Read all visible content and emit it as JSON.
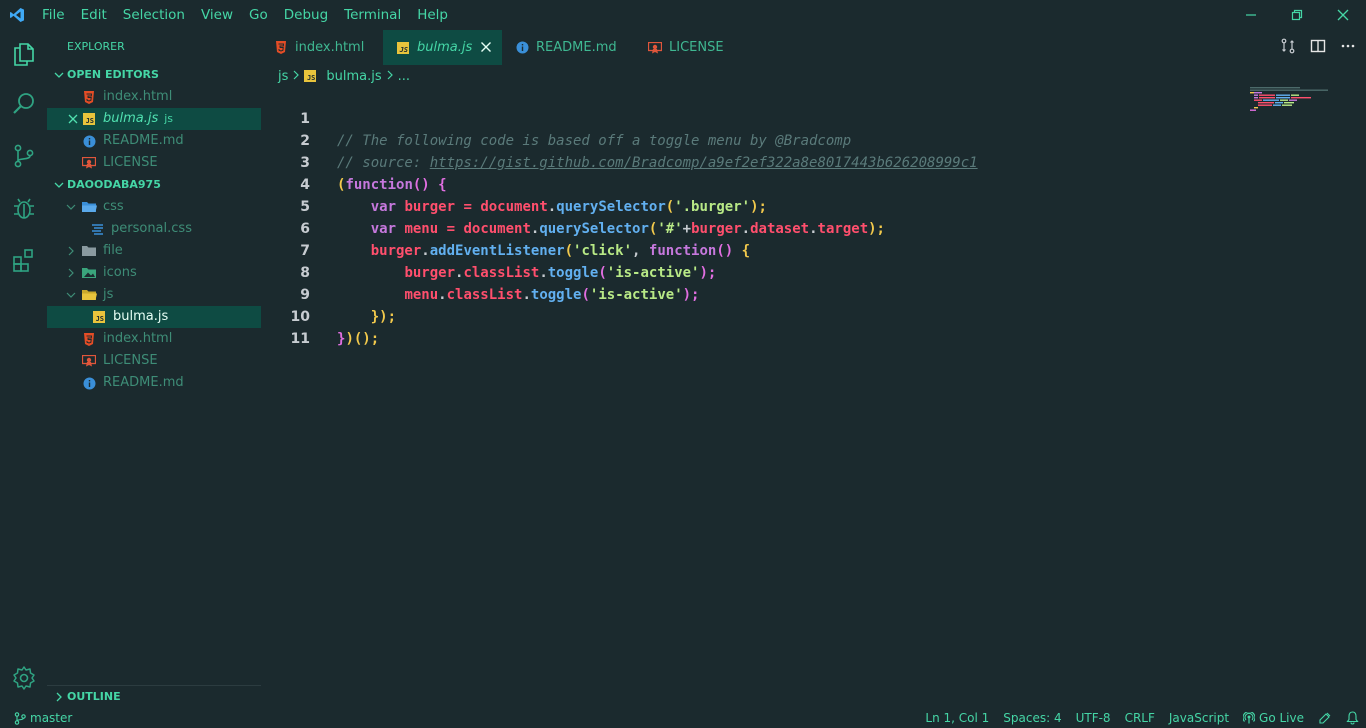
{
  "menu": [
    "File",
    "Edit",
    "Selection",
    "View",
    "Go",
    "Debug",
    "Terminal",
    "Help"
  ],
  "sidebar": {
    "title": "EXPLORER",
    "open_editors_label": "OPEN EDITORS",
    "open_editors": [
      {
        "name": "index.html",
        "icon": "html-icon"
      },
      {
        "name": "bulma.js",
        "hint": "js",
        "icon": "js-icon"
      },
      {
        "name": "README.md",
        "icon": "info-icon"
      },
      {
        "name": "LICENSE",
        "icon": "license-icon"
      }
    ],
    "folder_label": "DAOODABA975",
    "tree": [
      {
        "name": "css",
        "type": "folder-open"
      },
      {
        "name": "personal.css",
        "type": "file"
      },
      {
        "name": "file",
        "type": "folder"
      },
      {
        "name": "icons",
        "type": "folder"
      },
      {
        "name": "js",
        "type": "folder-open"
      },
      {
        "name": "bulma.js",
        "type": "file"
      },
      {
        "name": "index.html",
        "type": "file"
      },
      {
        "name": "LICENSE",
        "type": "file"
      },
      {
        "name": "README.md",
        "type": "file"
      }
    ],
    "outline_label": "OUTLINE"
  },
  "tabs": [
    {
      "label": "index.html",
      "icon": "html-icon"
    },
    {
      "label": "bulma.js",
      "icon": "js-icon",
      "active": true
    },
    {
      "label": "README.md",
      "icon": "info-icon"
    },
    {
      "label": "LICENSE",
      "icon": "license-icon"
    }
  ],
  "breadcrumb": {
    "folder": "js",
    "file": "bulma.js",
    "more": "..."
  },
  "code": {
    "line_numbers": [
      "1",
      "2",
      "3",
      "4",
      "5",
      "6",
      "7",
      "8",
      "9",
      "10",
      "11"
    ],
    "l1": "// The following code is based off a toggle menu by @Bradcomp",
    "l2a": "// source: ",
    "l2b": "https://gist.github.com/Bradcomp/a9ef2ef322a8e8017443b626208999c1",
    "l3": [
      "(",
      "function",
      "() ",
      "{"
    ],
    "l4": [
      "var",
      " burger ",
      "=",
      " document",
      ".",
      "querySelector",
      "(",
      "'.burger'",
      ");"
    ],
    "l5": [
      "var",
      " menu ",
      "=",
      " document",
      ".",
      "querySelector",
      "(",
      "'#'",
      "+",
      "burger",
      ".",
      "dataset",
      ".",
      "target",
      ");"
    ],
    "l6": [
      "burger",
      ".",
      "addEventListener",
      "(",
      "'click'",
      ", ",
      "function",
      "() ",
      "{"
    ],
    "l7": [
      "burger",
      ".",
      "classList",
      ".",
      "toggle",
      "(",
      "'is-active'",
      ");"
    ],
    "l8": [
      "menu",
      ".",
      "classList",
      ".",
      "toggle",
      "(",
      "'is-active'",
      ");"
    ],
    "l9": [
      "}",
      ");"
    ],
    "l10": [
      "}",
      ")",
      "();"
    ]
  },
  "status": {
    "branch": "master",
    "position": "Ln 1, Col 1",
    "spaces": "Spaces: 4",
    "encoding": "UTF-8",
    "eol": "CRLF",
    "language": "JavaScript",
    "golive": "Go Live"
  },
  "colors": {
    "background": "#1b2a2e",
    "accent": "#45d6a6",
    "selection": "#0e4b43"
  }
}
